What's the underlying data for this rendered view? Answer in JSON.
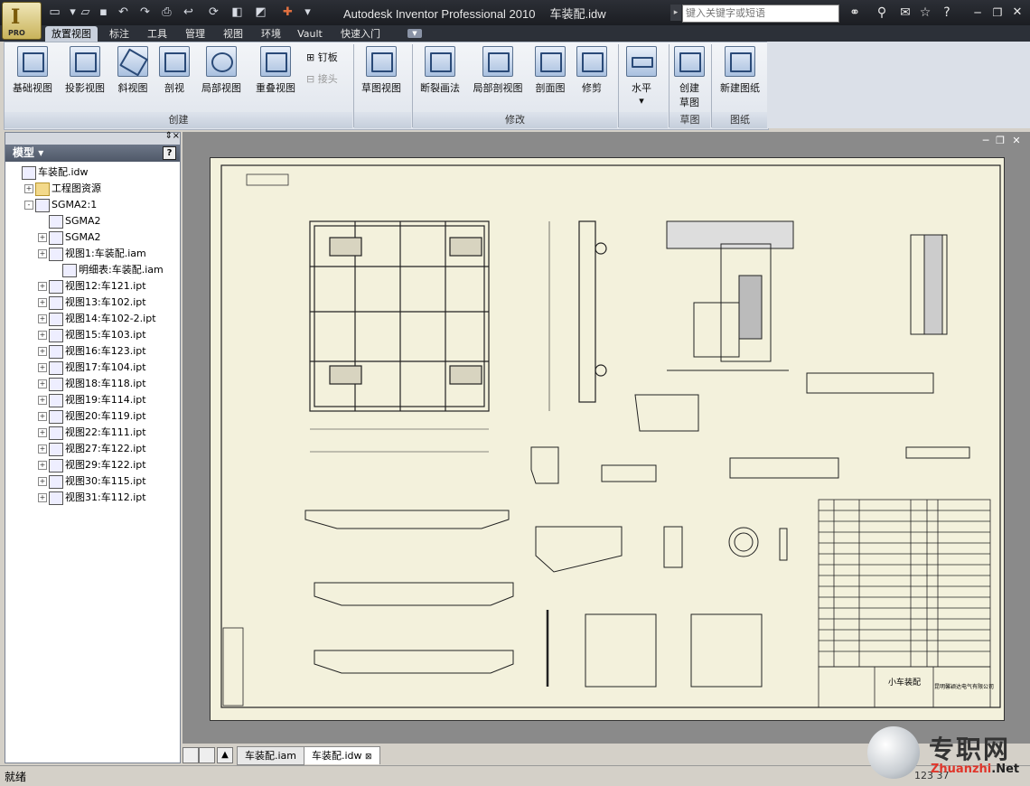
{
  "app": {
    "title": "Autodesk Inventor Professional 2010",
    "document": "车装配.idw",
    "badge": "PRO",
    "logo_letter": "I"
  },
  "search": {
    "placeholder": "键入关键字或短语"
  },
  "tabs": [
    "放置视图",
    "标注",
    "工具",
    "管理",
    "视图",
    "环境",
    "Vault",
    "快速入门"
  ],
  "active_tab": "放置视图",
  "ribbon": {
    "groups": [
      {
        "label": "创建",
        "buttons": [
          "基础视图",
          "投影视图",
          "斜视图",
          "剖视",
          "局部视图",
          "重叠视图"
        ],
        "small": [
          "钉板",
          "接头"
        ]
      },
      {
        "label": "",
        "buttons": [
          "草图视图"
        ]
      },
      {
        "label": "修改",
        "buttons": [
          "断裂画法",
          "局部剖视图",
          "剖面图",
          "修剪"
        ]
      },
      {
        "label": "",
        "buttons": [
          "水平"
        ]
      },
      {
        "label": "草图",
        "buttons": [
          "创建\n草图"
        ]
      },
      {
        "label": "图纸",
        "buttons": [
          "新建图纸"
        ]
      }
    ]
  },
  "browser": {
    "title": "模型",
    "help": "?",
    "tree": [
      {
        "label": "车装配.idw",
        "level": 0,
        "expander": ""
      },
      {
        "label": "工程图资源",
        "level": 1,
        "expander": "+"
      },
      {
        "label": "SGMA2:1",
        "level": 1,
        "expander": "-"
      },
      {
        "label": "SGMA2",
        "level": 2,
        "expander": ""
      },
      {
        "label": "SGMA2",
        "level": 2,
        "expander": "+"
      },
      {
        "label": "视图1:车装配.iam",
        "level": 2,
        "expander": "+"
      },
      {
        "label": "明细表:车装配.iam",
        "level": 3,
        "expander": ""
      },
      {
        "label": "视图12:车121.ipt",
        "level": 2,
        "expander": "+"
      },
      {
        "label": "视图13:车102.ipt",
        "level": 2,
        "expander": "+"
      },
      {
        "label": "视图14:车102-2.ipt",
        "level": 2,
        "expander": "+"
      },
      {
        "label": "视图15:车103.ipt",
        "level": 2,
        "expander": "+"
      },
      {
        "label": "视图16:车123.ipt",
        "level": 2,
        "expander": "+"
      },
      {
        "label": "视图17:车104.ipt",
        "level": 2,
        "expander": "+"
      },
      {
        "label": "视图18:车118.ipt",
        "level": 2,
        "expander": "+"
      },
      {
        "label": "视图19:车114.ipt",
        "level": 2,
        "expander": "+"
      },
      {
        "label": "视图20:车119.ipt",
        "level": 2,
        "expander": "+"
      },
      {
        "label": "视图22:车111.ipt",
        "level": 2,
        "expander": "+"
      },
      {
        "label": "视图27:车122.ipt",
        "level": 2,
        "expander": "+"
      },
      {
        "label": "视图29:车122.ipt",
        "level": 2,
        "expander": "+"
      },
      {
        "label": "视图30:车115.ipt",
        "level": 2,
        "expander": "+"
      },
      {
        "label": "视图31:车112.ipt",
        "level": 2,
        "expander": "+"
      }
    ]
  },
  "drawing": {
    "title_block": "小车装配",
    "company": "昆明馨颖达电气有限公司"
  },
  "doc_tabs": [
    {
      "label": "车装配.iam",
      "active": false
    },
    {
      "label": "车装配.idw",
      "active": true
    }
  ],
  "status": {
    "text": "就绪",
    "numbers": "123  37"
  },
  "watermark": {
    "cn": "专职网",
    "en_prefix": "Zhuanzhi",
    "en_suffix": ".Net"
  }
}
